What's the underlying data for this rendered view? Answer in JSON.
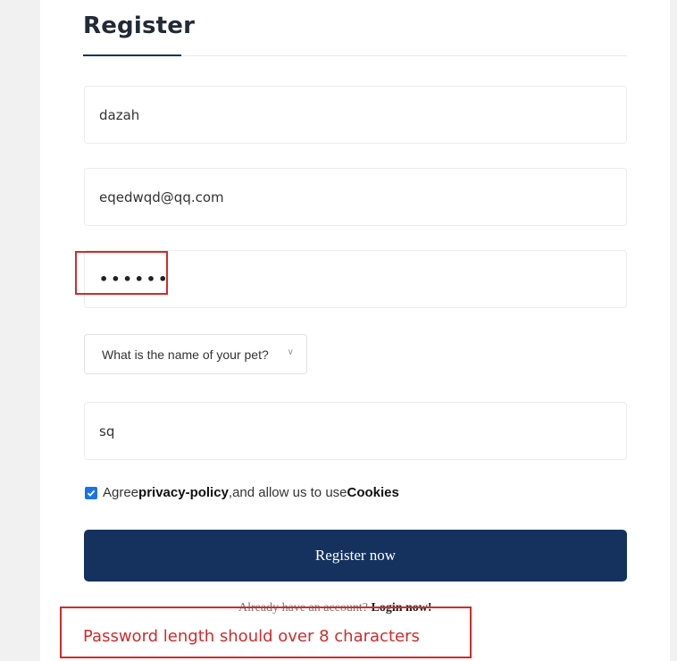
{
  "form": {
    "title": "Register",
    "username_value": "dazah",
    "email_value": "eqedwqd@qq.com",
    "password_masked": "••••••",
    "security_question_selected": "What is the name of your pet?",
    "security_answer_value": "sq",
    "agree_prefix": "Agree ",
    "privacy_link": "privacy-policy",
    "agree_middle": ",and allow us to use ",
    "cookies_link": "Cookies",
    "agree_checked": true,
    "register_button": "Register now",
    "login_prompt": "Already have an account? ",
    "login_link": "Login now!"
  },
  "error": {
    "message": "Password length should over 8 characters"
  },
  "colors": {
    "primary": "#15325f",
    "error": "#d12b2b",
    "checkbox": "#1a73e8"
  },
  "icons": {
    "select_chevron": "chevron-down-icon",
    "checkbox": "check-icon"
  }
}
